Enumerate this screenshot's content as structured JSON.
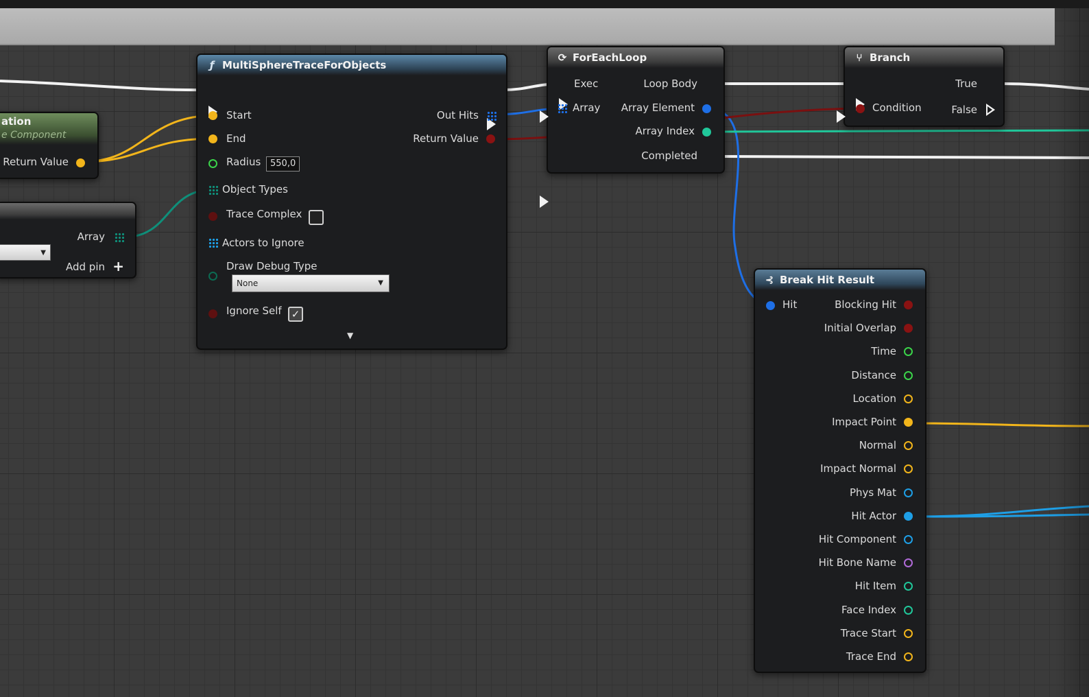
{
  "nodes": {
    "partial_left": {
      "title": "ation",
      "subtitle": "e Component",
      "return_label": "Return Value"
    },
    "make_array": {
      "array_label": "Array",
      "add_pin_label": "Add pin",
      "add_pin_icon": "+"
    },
    "multisphere": {
      "title": "MultiSphereTraceForObjects",
      "icon": "function-icon",
      "pins": {
        "start": "Start",
        "end": "End",
        "radius": "Radius",
        "radius_value": "550,0",
        "object_types": "Object Types",
        "trace_complex": "Trace Complex",
        "actors_to_ignore": "Actors to Ignore",
        "draw_debug_type": "Draw Debug Type",
        "draw_debug_value": "None",
        "ignore_self": "Ignore Self",
        "out_hits": "Out Hits",
        "return_value": "Return Value"
      },
      "trace_complex_checked": false,
      "ignore_self_checked": true
    },
    "foreach": {
      "title": "ForEachLoop",
      "icon": "loop-icon",
      "pins": {
        "exec": "Exec",
        "array": "Array",
        "loop_body": "Loop Body",
        "array_element": "Array Element",
        "array_index": "Array Index",
        "completed": "Completed"
      }
    },
    "branch": {
      "title": "Branch",
      "icon": "branch-icon",
      "pins": {
        "condition": "Condition",
        "true": "True",
        "false": "False"
      }
    },
    "break_hit": {
      "title": "Break Hit Result",
      "icon": "break-struct-icon",
      "hit": "Hit",
      "outputs": [
        {
          "label": "Blocking Hit",
          "color": "#8a1212",
          "kind": "dot"
        },
        {
          "label": "Initial Overlap",
          "color": "#8a1212",
          "kind": "dot"
        },
        {
          "label": "Time",
          "color": "#3bd44a",
          "kind": "ring"
        },
        {
          "label": "Distance",
          "color": "#3bd44a",
          "kind": "ring"
        },
        {
          "label": "Location",
          "color": "#f2b51b",
          "kind": "ring"
        },
        {
          "label": "Impact Point",
          "color": "#f2b51b",
          "kind": "dot"
        },
        {
          "label": "Normal",
          "color": "#f2b51b",
          "kind": "ring"
        },
        {
          "label": "Impact Normal",
          "color": "#f2b51b",
          "kind": "ring"
        },
        {
          "label": "Phys Mat",
          "color": "#1e9fe6",
          "kind": "ring"
        },
        {
          "label": "Hit Actor",
          "color": "#1e9fe6",
          "kind": "dot"
        },
        {
          "label": "Hit Component",
          "color": "#1e9fe6",
          "kind": "ring"
        },
        {
          "label": "Hit Bone Name",
          "color": "#b06ad8",
          "kind": "ring"
        },
        {
          "label": "Hit Item",
          "color": "#20c79a",
          "kind": "ring"
        },
        {
          "label": "Face Index",
          "color": "#20c79a",
          "kind": "ring"
        },
        {
          "label": "Trace Start",
          "color": "#f2b51b",
          "kind": "ring"
        },
        {
          "label": "Trace End",
          "color": "#f2b51b",
          "kind": "ring"
        }
      ]
    }
  },
  "colors": {
    "exec": "#f2f2f2",
    "vector": "#f2b51b",
    "float": "#3bd44a",
    "bool": "#8a1212",
    "struct": "#1e6fe6",
    "object": "#1e9fe6",
    "int": "#20c79a",
    "enum": "#0b6b52"
  }
}
